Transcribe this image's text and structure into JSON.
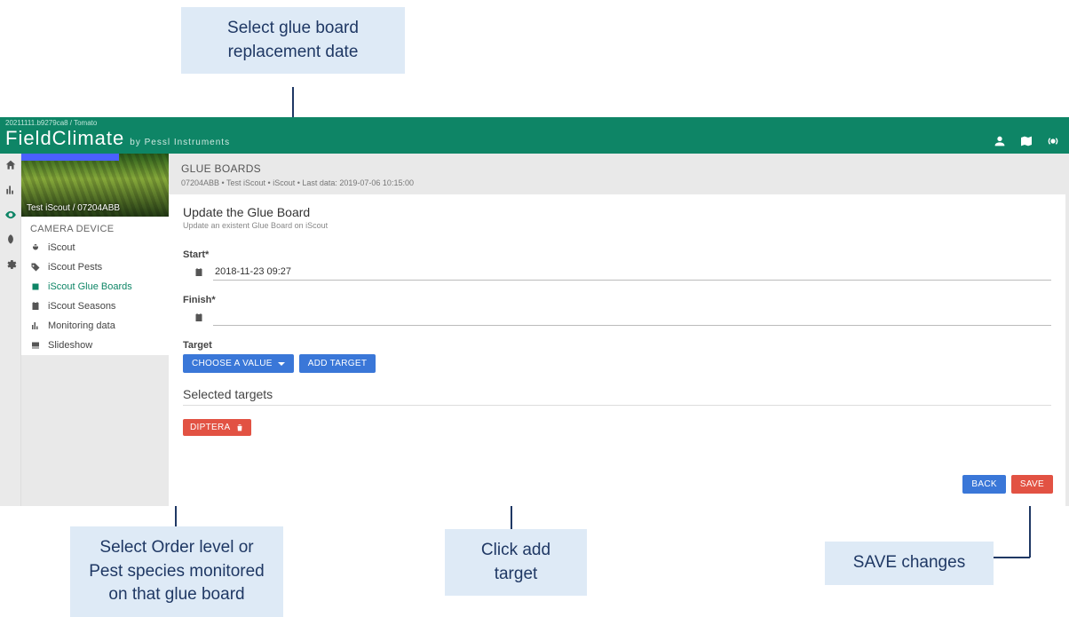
{
  "callouts": {
    "top": "Select glue board replacement date",
    "bottom_left": "Select Order level or Pest species monitored on that glue board",
    "bottom_mid": "Click add target",
    "bottom_right": "SAVE changes"
  },
  "topbar": {
    "build_line": "20211111.b9279ca8 / Tomato",
    "logo_main": "FieldClimate",
    "logo_sub": "by Pessl Instruments"
  },
  "sidebar": {
    "img_caption": "Test iScout / 07204ABB",
    "section_title": "CAMERA DEVICE",
    "items": [
      {
        "label": "iScout",
        "active": false,
        "icon": "bug"
      },
      {
        "label": "iScout Pests",
        "active": false,
        "icon": "tag"
      },
      {
        "label": "iScout Glue Boards",
        "active": true,
        "icon": "square"
      },
      {
        "label": "iScout Seasons",
        "active": false,
        "icon": "calendar"
      },
      {
        "label": "Monitoring data",
        "active": false,
        "icon": "chart"
      },
      {
        "label": "Slideshow",
        "active": false,
        "icon": "slides"
      }
    ]
  },
  "main": {
    "crumb_title": "GLUE BOARDS",
    "crumb_sub": "07204ABB • Test iScout • iScout • Last data: 2019-07-06 10:15:00",
    "card_title": "Update the Glue Board",
    "card_sub": "Update an existent Glue Board on iScout",
    "start_label": "Start*",
    "start_value": "2018-11-23 09:27",
    "finish_label": "Finish*",
    "finish_value": "",
    "target_label": "Target",
    "choose_btn": "CHOOSE A VALUE",
    "add_target_btn": "ADD TARGET",
    "selected_title": "Selected targets",
    "chip_label": "DIPTERA",
    "back_btn": "BACK",
    "save_btn": "SAVE"
  }
}
